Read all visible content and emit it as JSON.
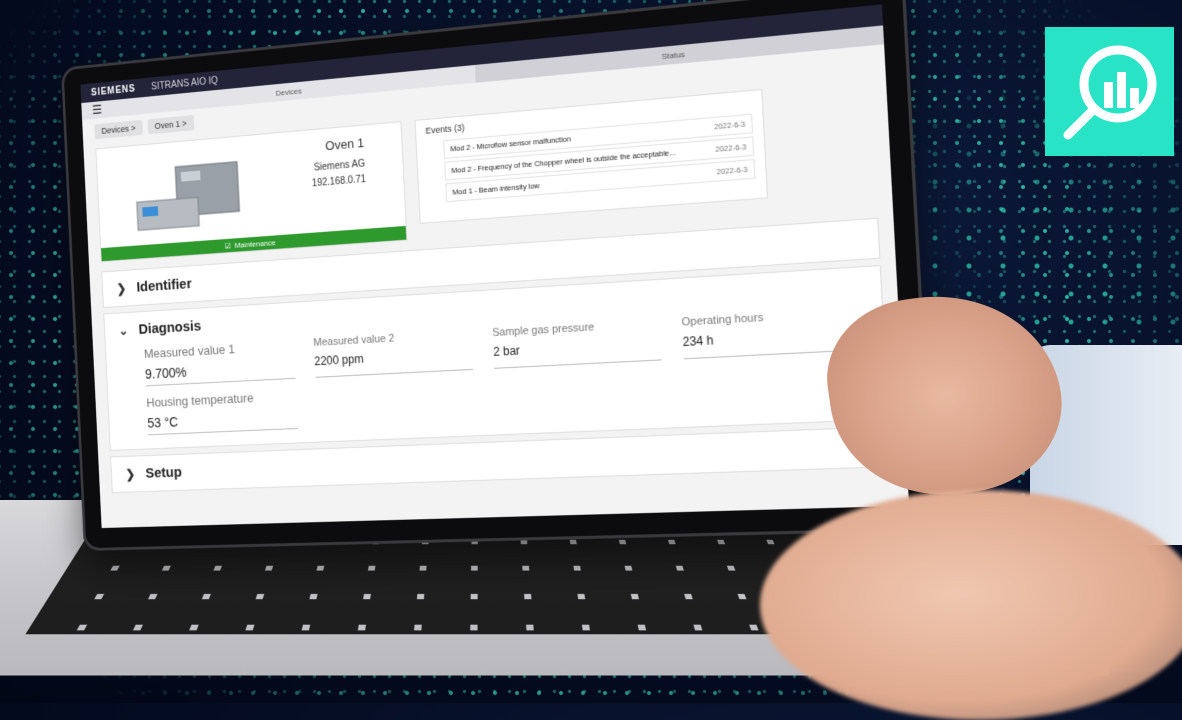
{
  "app": {
    "brand": "SIEMENS",
    "product": "SITRANS AIO IQ"
  },
  "nav": {
    "tabs": [
      {
        "label": "Devices"
      },
      {
        "label": "Status"
      }
    ]
  },
  "breadcrumb": [
    {
      "label": "Devices >"
    },
    {
      "label": "Oven 1 >"
    }
  ],
  "device": {
    "name": "Oven 1",
    "manufacturer": "Siemens AG",
    "ip": "192.168.0.71",
    "status": "Maintenance"
  },
  "events": {
    "title": "Events (3)",
    "items": [
      {
        "text": "Mod 2 - Microflow sensor malfunction",
        "date": "2022-6-3"
      },
      {
        "text": "Mod 2 - Frequency of the Chopper wheel is outside the acceptable...",
        "date": "2022-6-3"
      },
      {
        "text": "Mod 1 - Beam intensity low",
        "date": "2022-6-3"
      }
    ]
  },
  "sections": {
    "identifier": {
      "title": "Identifier"
    },
    "diagnosis": {
      "title": "Diagnosis",
      "fields": [
        {
          "label": "Measured value 1",
          "value": "9.700%"
        },
        {
          "label": "Measured value 2",
          "value": "2200 ppm"
        },
        {
          "label": "Sample gas pressure",
          "value": "2 bar"
        },
        {
          "label": "Operating hours",
          "value": "234 h"
        },
        {
          "label": "Housing temperature",
          "value": "53 °C"
        }
      ]
    },
    "setup": {
      "title": "Setup"
    }
  },
  "colors": {
    "accent": "#29e3c6",
    "status_green": "#2e9a2e",
    "topbar": "#23233a",
    "background": "#050d24"
  },
  "icons": {
    "logo": "magnifier-chart-icon",
    "menu": "hamburger-icon",
    "status": "check-icon"
  }
}
